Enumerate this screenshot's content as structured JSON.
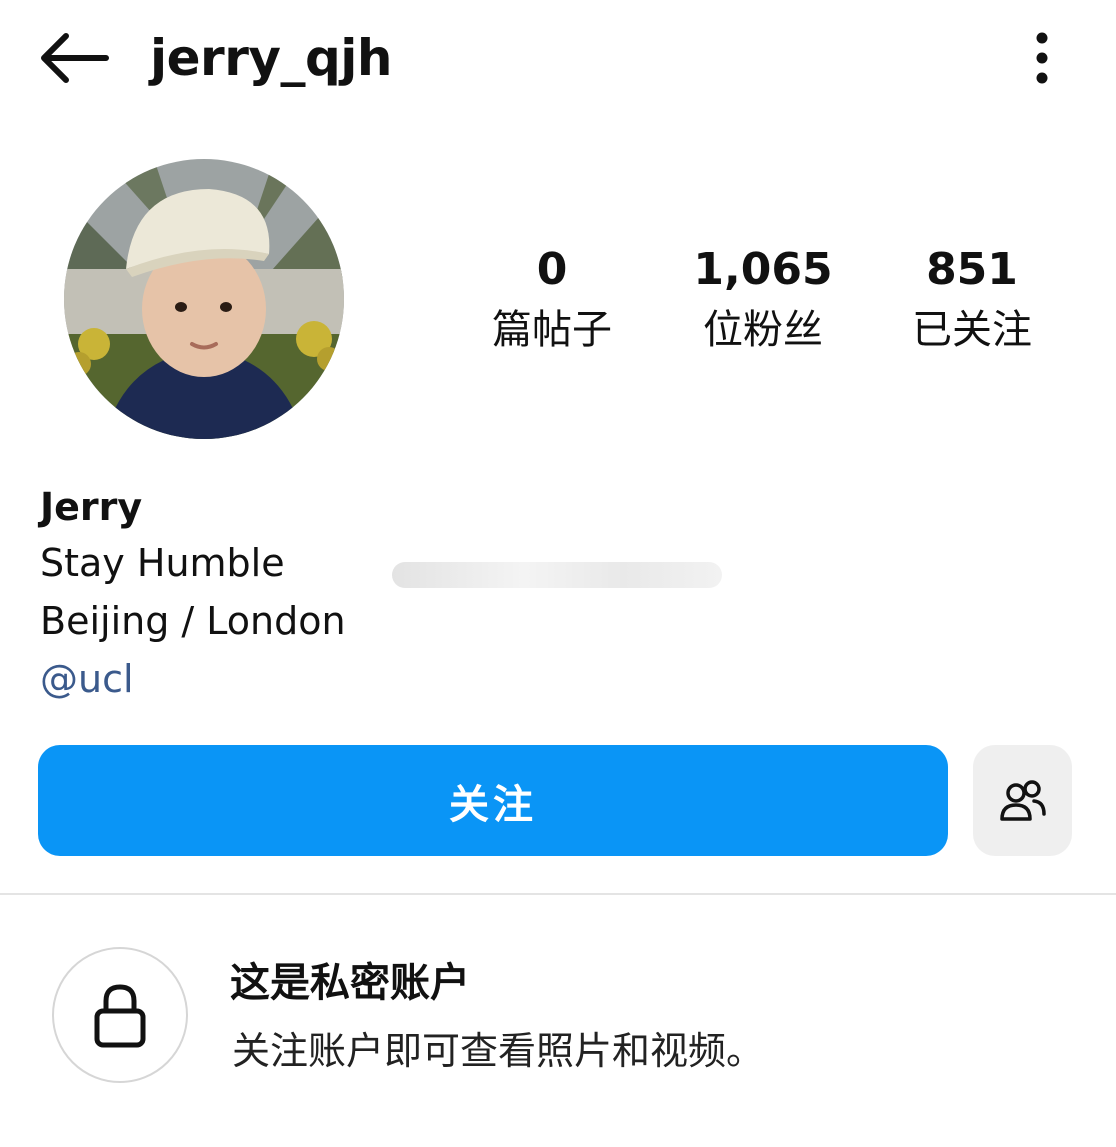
{
  "header": {
    "username": "jerry_qjh",
    "back_icon": "arrow-left-icon",
    "more_icon": "more-vertical-icon"
  },
  "profile": {
    "avatar_icon": "profile-photo",
    "stats": [
      {
        "value": "0",
        "label": "篇帖子"
      },
      {
        "value": "1,065",
        "label": "位粉丝"
      },
      {
        "value": "851",
        "label": "已关注"
      }
    ],
    "bio": {
      "name": "Jerry",
      "line1": "Stay Humble",
      "line2": "Beijing / London",
      "link": "@ucl"
    }
  },
  "actions": {
    "follow_label": "关注",
    "suggest_icon": "people-icon"
  },
  "private": {
    "lock_icon": "lock-icon",
    "title": "这是私密账户",
    "subtitle": "关注账户即可查看照片和视频。"
  },
  "colors": {
    "accent": "#0a95f6",
    "link": "#3b5a8c",
    "secondary_button": "#efefef"
  }
}
